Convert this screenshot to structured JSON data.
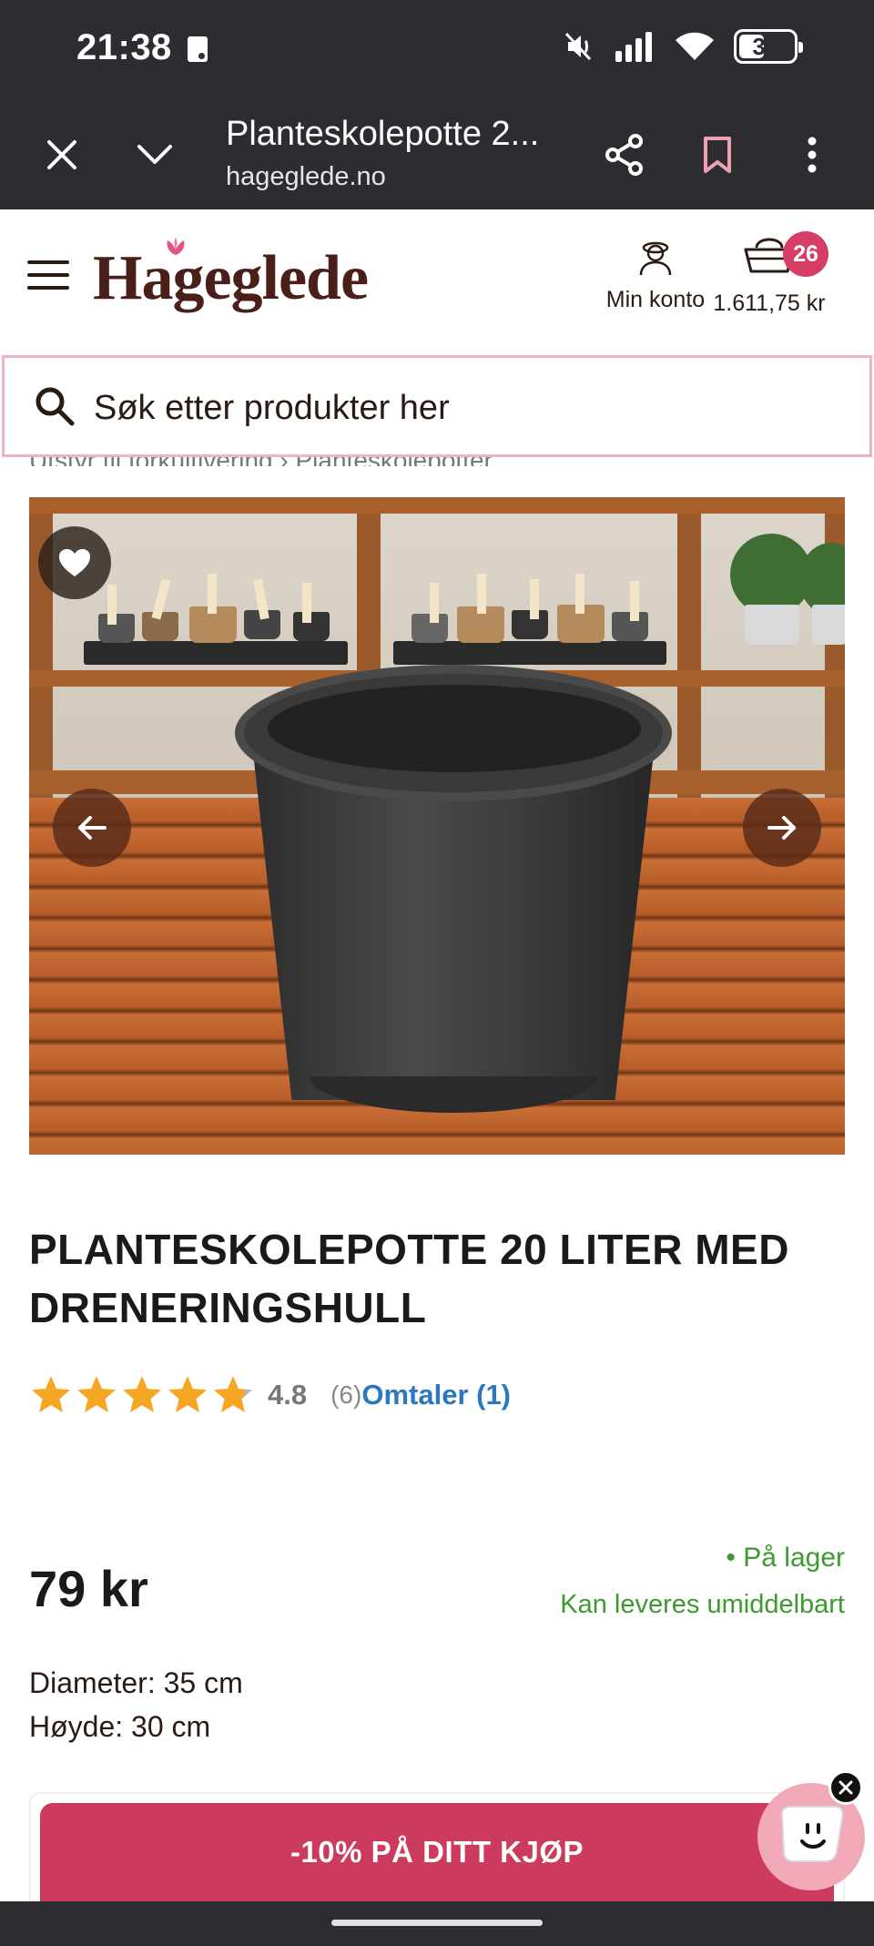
{
  "status_bar": {
    "time": "21:38",
    "battery": "32"
  },
  "browser": {
    "title": "Planteskolepotte 2...",
    "url": "hageglede.no"
  },
  "header": {
    "logo": "Hageglede",
    "account_label": "Min konto",
    "cart_count": "26",
    "cart_total": "1.611,75 kr"
  },
  "search": {
    "placeholder": "Søk etter produkter her"
  },
  "breadcrumb": "Utstyr til forkultivering  ›  Planteskolepotter",
  "product": {
    "title": "PLANTESKOLEPOTTE 20 LITER MED DRENERINGSHULL",
    "rating_value": "4.8",
    "rating_fraction": 0.96,
    "rating_count": "(6)",
    "reviews_link": "Omtaler (1)",
    "price": "79 kr",
    "stock_status": "• På lager",
    "delivery": "Kan leveres umiddelbart",
    "specs": [
      "Diameter: 35 cm",
      "Høyde: 30 cm"
    ]
  },
  "promo": {
    "label": "-10% PÅ DITT KJØP"
  },
  "colors": {
    "brand": "#4a1f1a",
    "accent": "#cc3a5e",
    "link": "#2a78c0",
    "in_stock": "#3c9a2f",
    "star": "#f5a623"
  }
}
